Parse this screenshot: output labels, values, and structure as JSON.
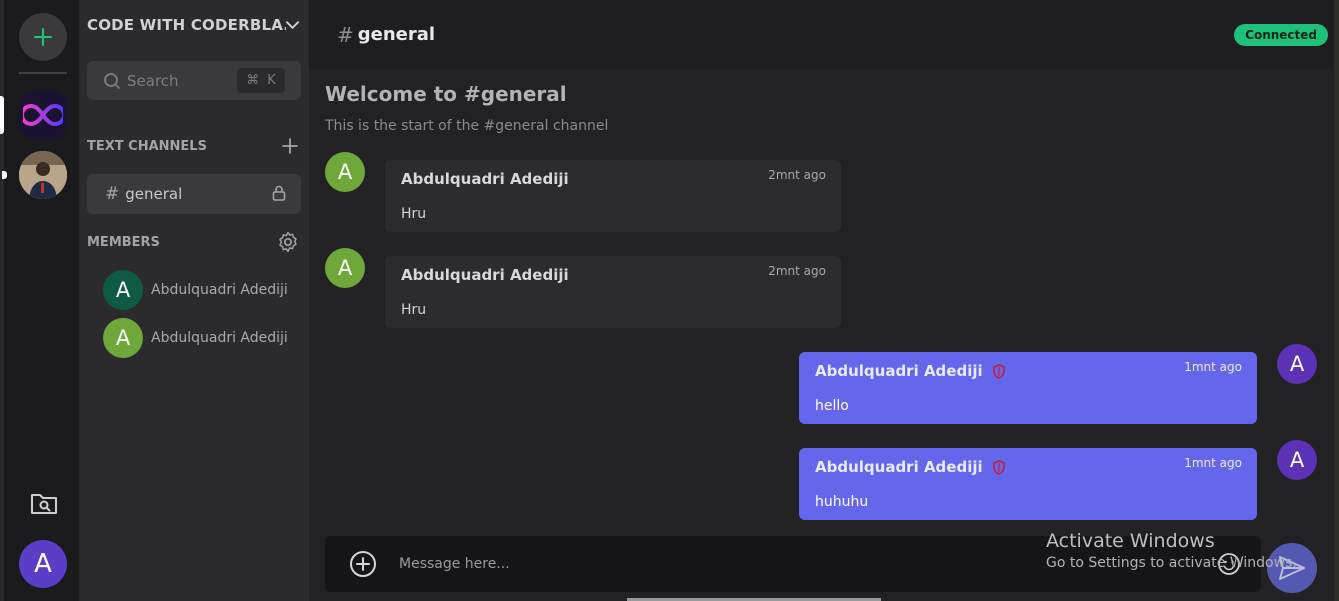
{
  "rail": {
    "add_icon": "plus-icon",
    "servers": [
      {
        "name": "infinity-server",
        "icon": "infinity-icon",
        "active": true
      },
      {
        "name": "profile-server",
        "icon": "photo-avatar",
        "active": false
      }
    ],
    "folder_icon": "folder-search-icon",
    "user_initial": "A",
    "colors": {
      "user_avatar": "#5b3ec7",
      "add_plus": "#22c27b"
    }
  },
  "sidebar": {
    "server_name": "CODE WITH CODERBLA...",
    "search": {
      "label": "Search",
      "shortcut_key": "⌘",
      "shortcut_letter": "K"
    },
    "text_channels_label": "TEXT CHANNELS",
    "channels": [
      {
        "name": "general",
        "hash": "#"
      }
    ],
    "members_label": "MEMBERS",
    "members": [
      {
        "initial": "A",
        "name": "Abdulquadri Adediji",
        "color": "#0e5b43"
      },
      {
        "initial": "A",
        "name": "Abdulquadri Adediji",
        "color": "#6ea83a"
      }
    ]
  },
  "main": {
    "channel_hash": "#",
    "channel_title": "general",
    "status": "Connected",
    "welcome_title": "Welcome to #general",
    "welcome_sub": "This is the start of the #general channel",
    "messages": [
      {
        "initial": "A",
        "author": "Abdulquadri Adediji",
        "time": "2mnt ago",
        "text": "Hru",
        "side": "left"
      },
      {
        "initial": "A",
        "author": "Abdulquadri Adediji",
        "time": "2mnt ago",
        "text": "Hru",
        "side": "left"
      },
      {
        "initial": "A",
        "author": "Abdulquadri Adediji",
        "time": "1mnt ago",
        "text": "hello",
        "side": "right"
      },
      {
        "initial": "A",
        "author": "Abdulquadri Adediji",
        "time": "1mnt ago",
        "text": "huhuhu",
        "side": "right"
      }
    ],
    "composer_placeholder": "Message here...",
    "colors": {
      "own_bubble": "#6466ec",
      "other_avatar": "#6ea83a",
      "own_avatar": "#5b32b5",
      "status": "#1ec07a"
    }
  },
  "watermark": {
    "line1": "Activate Windows",
    "line2": "Go to Settings to activate Windows."
  }
}
